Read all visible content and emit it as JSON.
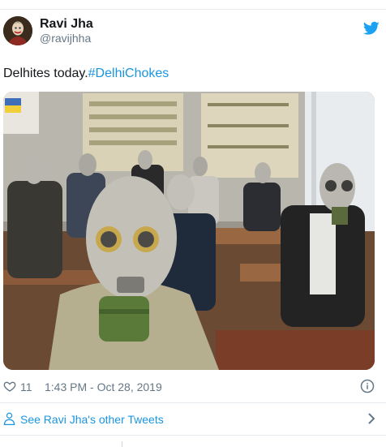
{
  "tweet": {
    "author": {
      "display_name": "Ravi Jha",
      "handle": "@ravijhha",
      "avatar_icon": "profile-avatar"
    },
    "text": "Delhites today.",
    "hashtag": "#DelhiChokes",
    "media": {
      "type": "photo"
    },
    "likes": "11",
    "timestamp": "1:43 PM - Oct 28, 2019",
    "see_more_label": "See Ravi Jha's other Tweets"
  },
  "icons": {
    "brand": "twitter-bird-icon",
    "like": "heart-icon",
    "info": "info-icon",
    "profile": "person-icon",
    "chevron": "chevron-right-icon"
  },
  "colors": {
    "link": "#1b95e0",
    "secondary_text": "#657786",
    "primary_text": "#14171a",
    "divider": "#e6ecf0"
  }
}
